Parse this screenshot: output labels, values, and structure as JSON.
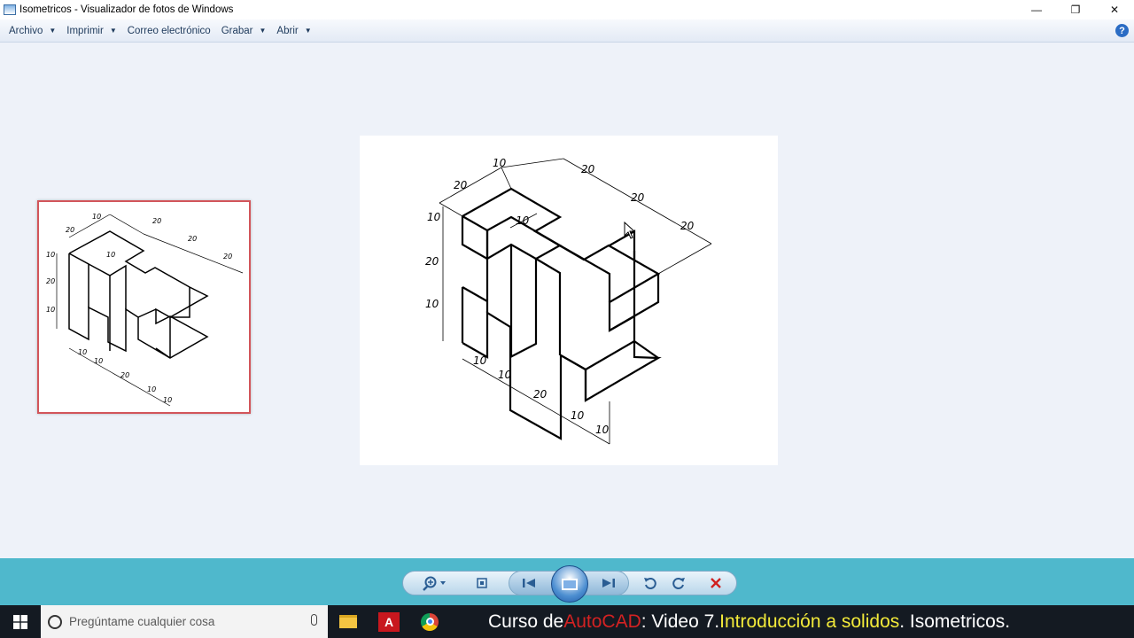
{
  "window": {
    "title": "Isometricos - Visualizador de fotos de Windows",
    "minimize_glyph": "—",
    "restore_glyph": "❐",
    "close_glyph": "✕"
  },
  "menu": {
    "items": [
      {
        "label": "Archivo",
        "has_dropdown": true
      },
      {
        "label": "Imprimir",
        "has_dropdown": true
      },
      {
        "label": "Correo electrónico",
        "has_dropdown": false
      },
      {
        "label": "Grabar",
        "has_dropdown": true
      },
      {
        "label": "Abrir",
        "has_dropdown": true
      }
    ],
    "help_glyph": "?"
  },
  "drawing": {
    "dimensions": [
      "20",
      "10",
      "20",
      "20",
      "20",
      "10",
      "10",
      "20",
      "10",
      "10",
      "10",
      "20",
      "10",
      "10"
    ]
  },
  "controls": {
    "zoom_icon": "zoom-icon",
    "fit_icon": "actual-size-icon",
    "previous_icon": "previous-icon",
    "slideshow_icon": "slideshow-icon",
    "next_icon": "next-icon",
    "rotate_left_icon": "rotate-ccw-icon",
    "rotate_right_icon": "rotate-cw-icon",
    "delete_icon": "delete-icon"
  },
  "taskbar": {
    "search_placeholder": "Pregúntame cualquier cosa",
    "caption": {
      "part1": "Curso de ",
      "part2": "AutoCAD",
      "part3": ": Video 7. ",
      "part4": "Introducción a solidos",
      "part5": ". Isometricos."
    }
  },
  "colors": {
    "accent_red": "#d42222",
    "accent_yellow": "#f3ea3a",
    "control_bar": "#4fb8cc",
    "taskbar": "#141a22",
    "thumbnail_border": "#d2555a"
  }
}
